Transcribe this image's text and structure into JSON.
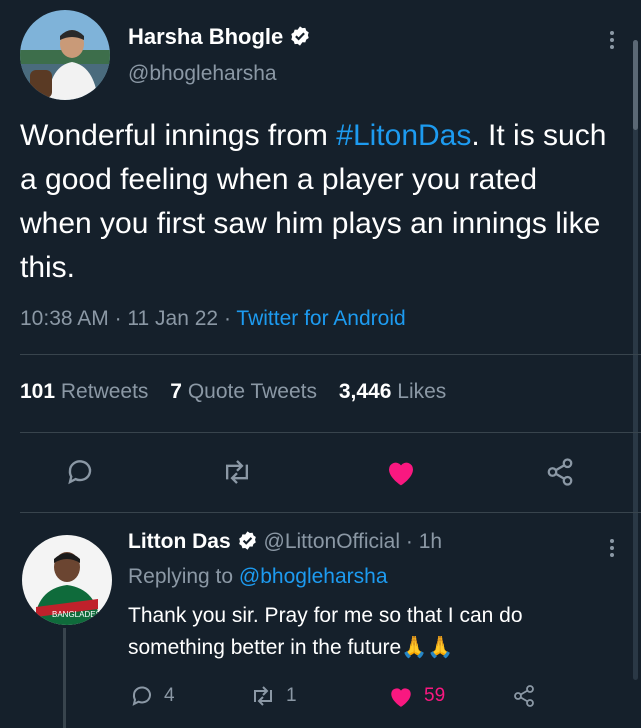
{
  "tweet": {
    "author_name": "Harsha Bhogle",
    "author_handle": "@bhogleharsha",
    "text_before": "Wonderful innings from ",
    "hashtag": "#LitonDas",
    "text_after": ". It is such a good feeling when a player you rated when you first saw him plays an innings like this.",
    "time": "10:38 AM",
    "date": "11 Jan 22",
    "source": "Twitter for Android",
    "dot": "·",
    "stats": {
      "retweets_count": "101",
      "retweets_label": "Retweets",
      "quotes_count": "7",
      "quotes_label": "Quote Tweets",
      "likes_count": "3,446",
      "likes_label": "Likes"
    },
    "actions": [
      "reply-icon",
      "retweet-icon",
      "like-icon",
      "share-icon"
    ]
  },
  "reply": {
    "author_name": "Litton Das",
    "author_handle": "@LittonOfficial",
    "dot": "·",
    "time_ago": "1h",
    "replying_label": "Replying to",
    "replying_handle": "@bhogleharsha",
    "text": "Thank you sir.  Pray for me so that I can do something better in the future",
    "emoji": "🙏🙏",
    "jersey_text": "BANGLADESH",
    "reply_count": "4",
    "retweet_count": "1",
    "like_count": "59"
  },
  "colors": {
    "background": "#15202b",
    "accent": "#1d9bf0",
    "like": "#f91880",
    "muted": "#8b98a5",
    "divider": "#38444d"
  }
}
